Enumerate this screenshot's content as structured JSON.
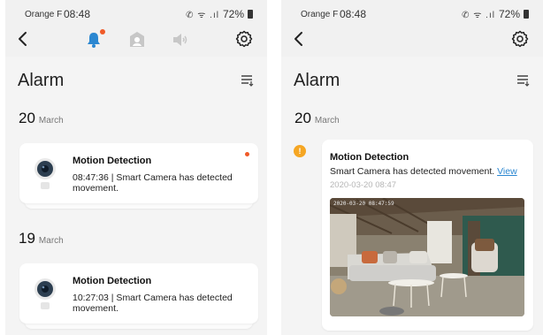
{
  "status_bar": {
    "carrier": "Orange F",
    "time": "08:48",
    "signal_glyphs": "✆ ᯤ .ıl",
    "battery": "72%"
  },
  "screen_left": {
    "title": "Alarm",
    "toolbar_icons": [
      "back-arrow-icon",
      "bell-icon",
      "person-icon",
      "speaker-icon",
      "gear-icon"
    ],
    "groups": [
      {
        "day": "20",
        "month": "March",
        "items": [
          {
            "title": "Motion Detection",
            "message": "08:47:36 | Smart Camera has detected movement.",
            "unread": true
          }
        ]
      },
      {
        "day": "19",
        "month": "March",
        "items": [
          {
            "title": "Motion Detection",
            "message": "10:27:03 | Smart Camera has detected movement.",
            "unread": false
          }
        ]
      }
    ]
  },
  "screen_right": {
    "title": "Alarm",
    "group": {
      "day": "20",
      "month": "March"
    },
    "event": {
      "index_badge": "!",
      "title": "Motion Detection",
      "message": "Smart Camera has detected movement.",
      "view_link": "View",
      "timestamp": "2020-03-20 08:47",
      "snapshot_stamp": "2020-03-20 08:47:59"
    }
  },
  "colors": {
    "accent_blue": "#2b87d1",
    "unread_dot": "#f05a28",
    "timeline_badge": "#f5a623",
    "background": "#f4f4f4"
  }
}
